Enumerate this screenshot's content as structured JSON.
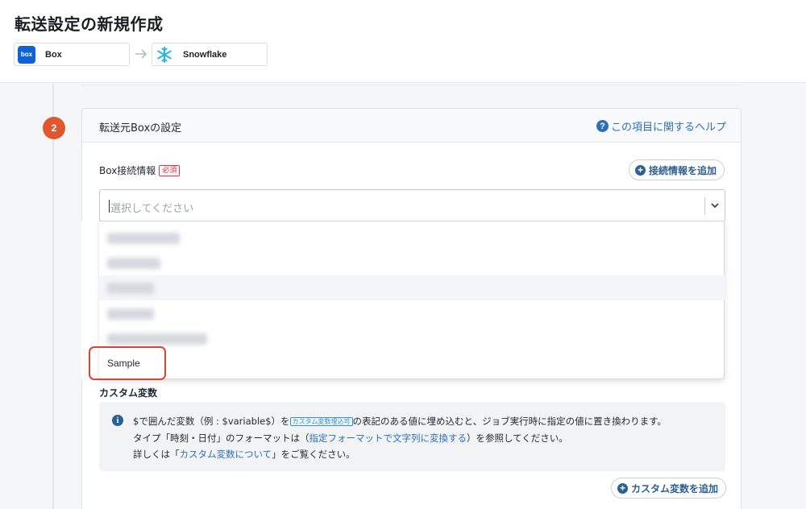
{
  "page": {
    "title": "転送設定の新規作成",
    "source_connector": "Box",
    "source_logo_text": "box",
    "destination_connector": "Snowflake"
  },
  "step": {
    "number": "2",
    "title": "転送元Boxの設定",
    "help_link": "この項目に関するヘルプ"
  },
  "connection_field": {
    "label": "Box接続情報",
    "required_badge": "必須",
    "add_button": "接続情報を追加",
    "placeholder": "選択してください",
    "options": [
      {
        "label": "",
        "redacted": true
      },
      {
        "label": "",
        "redacted": true
      },
      {
        "label": "",
        "redacted": true
      },
      {
        "label": "",
        "redacted": true
      },
      {
        "label": "",
        "redacted": true
      },
      {
        "label": "Sample",
        "redacted": false
      }
    ],
    "highlighted_option": "Sample"
  },
  "custom_variables": {
    "title": "カスタム変数",
    "line1_part1": "$で囲んだ変数（例 : $variable$）を",
    "line1_tag": "カスタム変数埋込可",
    "line1_part2": "の表記のある値に埋め込むと、ジョブ実行時に指定の値に置き換わります。",
    "line2_part1": "タイプ「時刻・日付」のフォーマットは（",
    "line2_link": "指定フォーマットで文字列に変換する",
    "line2_part2": "）を参照してください。",
    "line3_part1": "詳しくは「",
    "line3_link": "カスタム変数について",
    "line3_part2": "」をご覧ください。",
    "add_button": "カスタム変数を追加"
  },
  "colors": {
    "accent_link": "#2d6fb7",
    "step_badge": "#e0572f",
    "required": "#d23a4a",
    "highlight_ring": "#e0432f"
  },
  "icons": {
    "help": "question-circle-icon",
    "add": "plus-circle-icon",
    "info": "info-circle-icon",
    "dropdown": "chevron-down-icon",
    "arrow": "arrow-right-icon"
  }
}
